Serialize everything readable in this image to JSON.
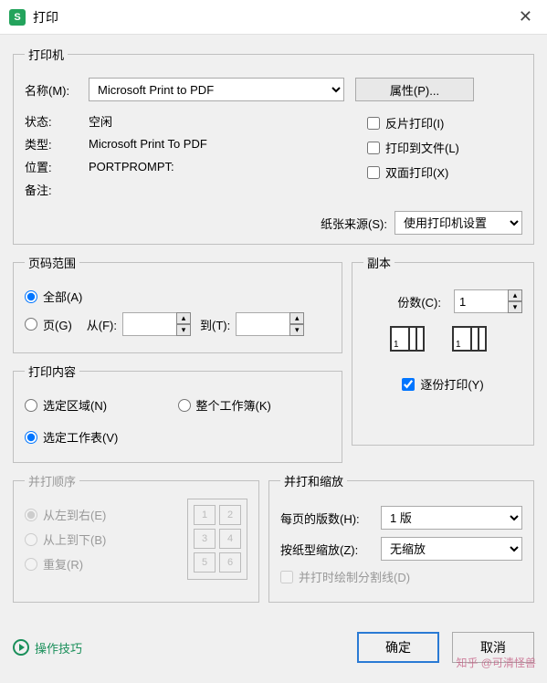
{
  "title": "打印",
  "printer": {
    "legend": "打印机",
    "name_label": "名称(M):",
    "name_value": "Microsoft Print to PDF",
    "properties_btn": "属性(P)...",
    "status_label": "状态:",
    "status_value": "空闲",
    "type_label": "类型:",
    "type_value": "Microsoft Print To PDF",
    "location_label": "位置:",
    "location_value": "PORTPROMPT:",
    "remark_label": "备注:",
    "remark_value": "",
    "chk_reverse": "反片打印(I)",
    "chk_tofile": "打印到文件(L)",
    "chk_duplex": "双面打印(X)",
    "paper_source_label": "纸张来源(S):",
    "paper_source_value": "使用打印机设置"
  },
  "page_range": {
    "legend": "页码范围",
    "all": "全部(A)",
    "pages": "页(G)",
    "from": "从(F):",
    "to": "到(T):"
  },
  "print_content": {
    "legend": "打印内容",
    "selected_area": "选定区域(N)",
    "workbook": "整个工作簿(K)",
    "selected_sheet": "选定工作表(V)"
  },
  "copies": {
    "legend": "副本",
    "count_label": "份数(C):",
    "count_value": "1",
    "collate": "逐份打印(Y)"
  },
  "sequence": {
    "legend": "并打顺序",
    "ltr": "从左到右(E)",
    "ttb": "从上到下(B)",
    "repeat": "重复(R)",
    "cells": [
      "1",
      "2",
      "3",
      "4",
      "5",
      "6"
    ]
  },
  "layout": {
    "legend": "并打和缩放",
    "per_page_label": "每页的版数(H):",
    "per_page_value": "1 版",
    "scale_label": "按纸型缩放(Z):",
    "scale_value": "无缩放",
    "draw_lines": "并打时绘制分割线(D)"
  },
  "footer": {
    "tips": "操作技巧",
    "ok": "确定",
    "cancel": "取消"
  },
  "watermark": "知乎 @可清怪兽"
}
